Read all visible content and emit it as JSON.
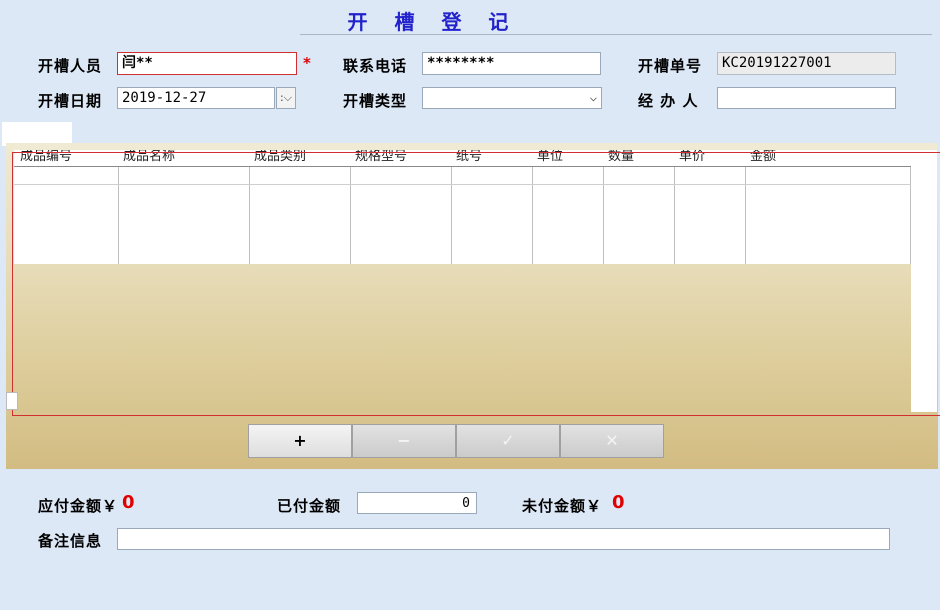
{
  "title": "开 槽 登 记",
  "form": {
    "operator_label": "开槽人员",
    "operator_value": "闫**",
    "required_mark": "*",
    "phone_label": "联系电话",
    "phone_value": "********",
    "order_no_label": "开槽单号",
    "order_no_value": "KC20191227001",
    "date_label": "开槽日期",
    "date_value": "2019-12-27",
    "type_label": "开槽类型",
    "type_value": "",
    "handler_label": "经 办 人",
    "handler_value": ""
  },
  "grid": {
    "columns": [
      "成品编号",
      "成品名称",
      "成品类别",
      "规格型号",
      "纸号",
      "单位",
      "数量",
      "单价",
      "金额"
    ]
  },
  "toolbar": {
    "add_label": "+",
    "remove_label": "−",
    "confirm_label": "✓",
    "cancel_label": "✕"
  },
  "summary": {
    "payable_label": "应付金额￥",
    "payable_value": "0",
    "paid_label": "已付金额",
    "paid_value": "0",
    "unpaid_label": "未付金额￥",
    "unpaid_value": "0",
    "remark_label": "备注信息",
    "remark_value": ""
  }
}
